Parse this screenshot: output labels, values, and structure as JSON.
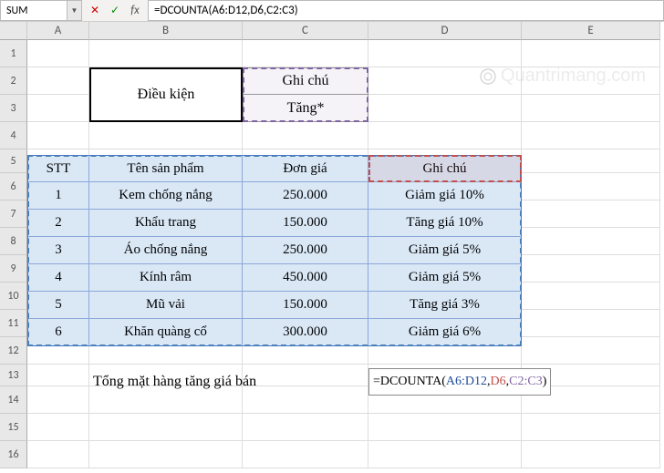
{
  "name_box": "SUM",
  "formula_bar": "=DCOUNTA(A6:D12,D6,C2:C3)",
  "columns": [
    "A",
    "B",
    "C",
    "D",
    "E"
  ],
  "rows": [
    "1",
    "2",
    "3",
    "4",
    "5",
    "6",
    "7",
    "8",
    "9",
    "10",
    "11",
    "12",
    "13",
    "14",
    "15",
    "16"
  ],
  "criteria": {
    "label": "Điều kiện",
    "header": "Ghi chú",
    "value": "Tăng*"
  },
  "table": {
    "headers": {
      "stt": "STT",
      "name": "Tên sản phẩm",
      "price": "Đơn giá",
      "note": "Ghi chú"
    },
    "rows": [
      {
        "stt": "1",
        "name": "Kem chống nắng",
        "price": "250.000",
        "note": "Giảm giá 10%"
      },
      {
        "stt": "2",
        "name": "Khẩu trang",
        "price": "150.000",
        "note": "Tăng giá 10%"
      },
      {
        "stt": "3",
        "name": "Áo chống nắng",
        "price": "250.000",
        "note": "Giảm giá 5%"
      },
      {
        "stt": "4",
        "name": "Kính râm",
        "price": "450.000",
        "note": "Giảm giá 5%"
      },
      {
        "stt": "5",
        "name": "Mũ vải",
        "price": "150.000",
        "note": "Tăng giá 3%"
      },
      {
        "stt": "6",
        "name": "Khăn quàng cổ",
        "price": "300.000",
        "note": "Giảm giá 6%"
      }
    ]
  },
  "summary_label": "Tổng mặt hàng tăng giá bán",
  "active_formula": {
    "prefix": "=DCOUNTA(",
    "r1": "A6:D12",
    "sep1": ",",
    "r2": "D6",
    "sep2": ",",
    "r3": "C2:C3",
    "suffix": ")"
  },
  "watermark": "Quantrimang.com"
}
